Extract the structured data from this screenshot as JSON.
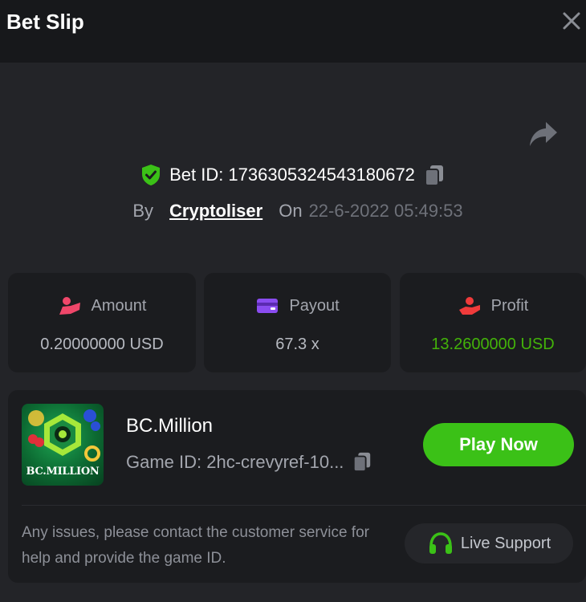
{
  "header": {
    "title": "Bet Slip",
    "close_icon": "close-icon"
  },
  "bet": {
    "id_text": "Bet ID: 1736305324543180672",
    "by_label": "By",
    "user": "Cryptoliser",
    "on_label": "On",
    "date": "22-6-2022 05:49:53"
  },
  "stats": {
    "amount": {
      "label": "Amount",
      "value": "0.20000000 USD",
      "icon": "coin-hand-icon",
      "color": "#f0476a"
    },
    "payout": {
      "label": "Payout",
      "value": "67.3 x",
      "icon": "wallet-card-icon",
      "color": "#8a4cf0"
    },
    "profit": {
      "label": "Profit",
      "value": "13.2600000 USD",
      "icon": "profit-hand-icon",
      "color": "#f03b3b",
      "value_color": "#43b309"
    }
  },
  "game": {
    "title": "BC.Million",
    "game_id": "Game ID: 2hc-crevyref-10...",
    "thumbnail_logo": "BC.MILLION",
    "play_label": "Play Now"
  },
  "help": {
    "text": "Any issues, please contact the customer service for help and provide the game ID.",
    "support_label": "Live Support"
  },
  "colors": {
    "accent_green": "#3bc117",
    "background": "#232428",
    "card": "#1b1c1f"
  }
}
